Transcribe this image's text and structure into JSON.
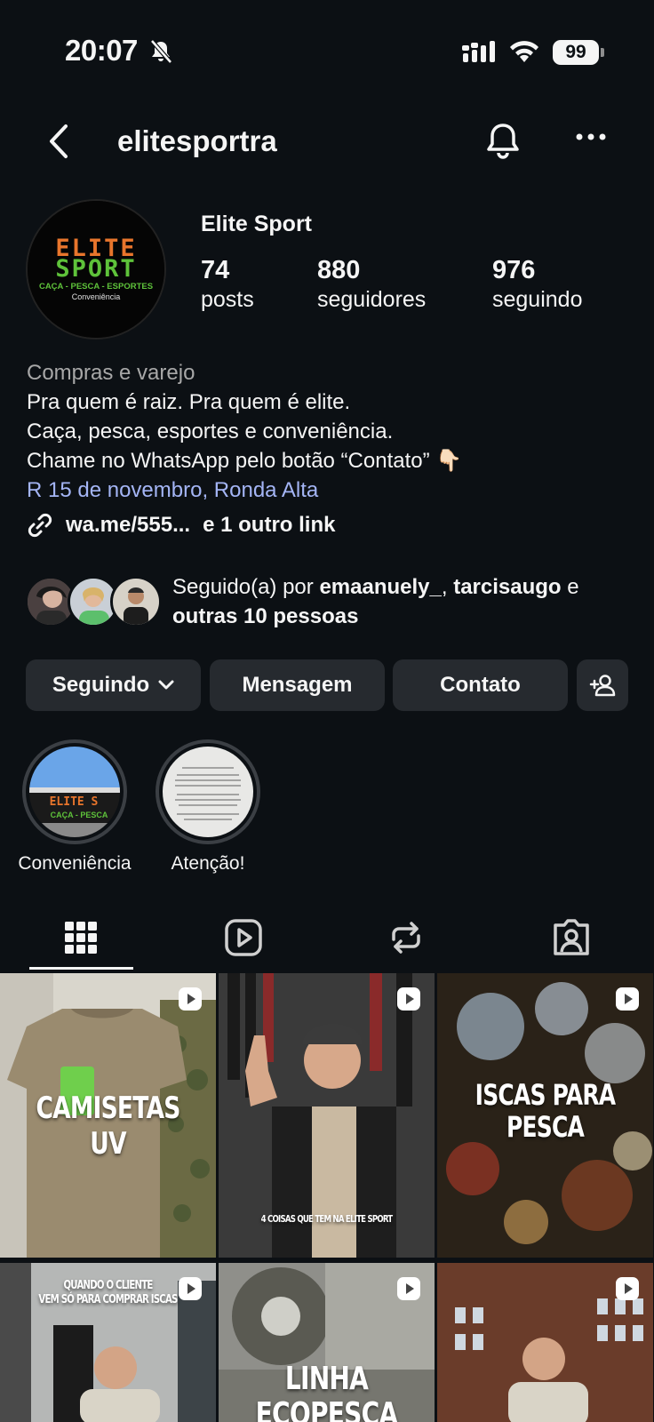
{
  "status_bar": {
    "time": "20:07",
    "battery": "99"
  },
  "header": {
    "username": "elitesportra"
  },
  "profile": {
    "display_name": "Elite Sport",
    "avatar": {
      "line1": "ELITE",
      "line2": "SPORT",
      "line3": "CAÇA - PESCA - ESPORTES",
      "line4": "Conveniência"
    },
    "stats": [
      {
        "value": "74",
        "label": "posts"
      },
      {
        "value": "880",
        "label": "seguidores"
      },
      {
        "value": "976",
        "label": "seguindo"
      }
    ],
    "bio": {
      "category": "Compras e varejo",
      "line1": "Pra quem é raiz. Pra quem é elite.",
      "line2": "Caça, pesca, esportes e conveniência.",
      "line3": "Chame no WhatsApp pelo botão “Contato” 👇🏻",
      "address": "R 15 de novembro, Ronda Alta"
    },
    "link": {
      "url": "wa.me/555...",
      "more": "e 1 outro link"
    },
    "followed_by": {
      "prefix": "Seguido(a) por ",
      "user1": "emaanuely_",
      "sep": ", ",
      "user2": "tarcisaugo",
      "conj": " e",
      "rest": "outras 10 pessoas"
    }
  },
  "actions": {
    "following": "Seguindo",
    "message": "Mensagem",
    "contact": "Contato"
  },
  "highlights": [
    {
      "label": "Conveniência"
    },
    {
      "label": "Atenção!"
    }
  ],
  "posts": [
    {
      "caption": "CAMISETAS UV"
    },
    {
      "caption": "4 COISAS QUE TEM NA ELITE SPORT"
    },
    {
      "caption_line1": "ISCAS PARA",
      "caption_line2": "PESCA"
    },
    {
      "caption_line1": "QUANDO O CLIENTE",
      "caption_line2": "VEM SÓ PARA COMPRAR ISCAS"
    },
    {
      "caption_line1": "LINHA",
      "caption_line2": "ECOPESCA"
    },
    {
      "caption": ""
    }
  ]
}
